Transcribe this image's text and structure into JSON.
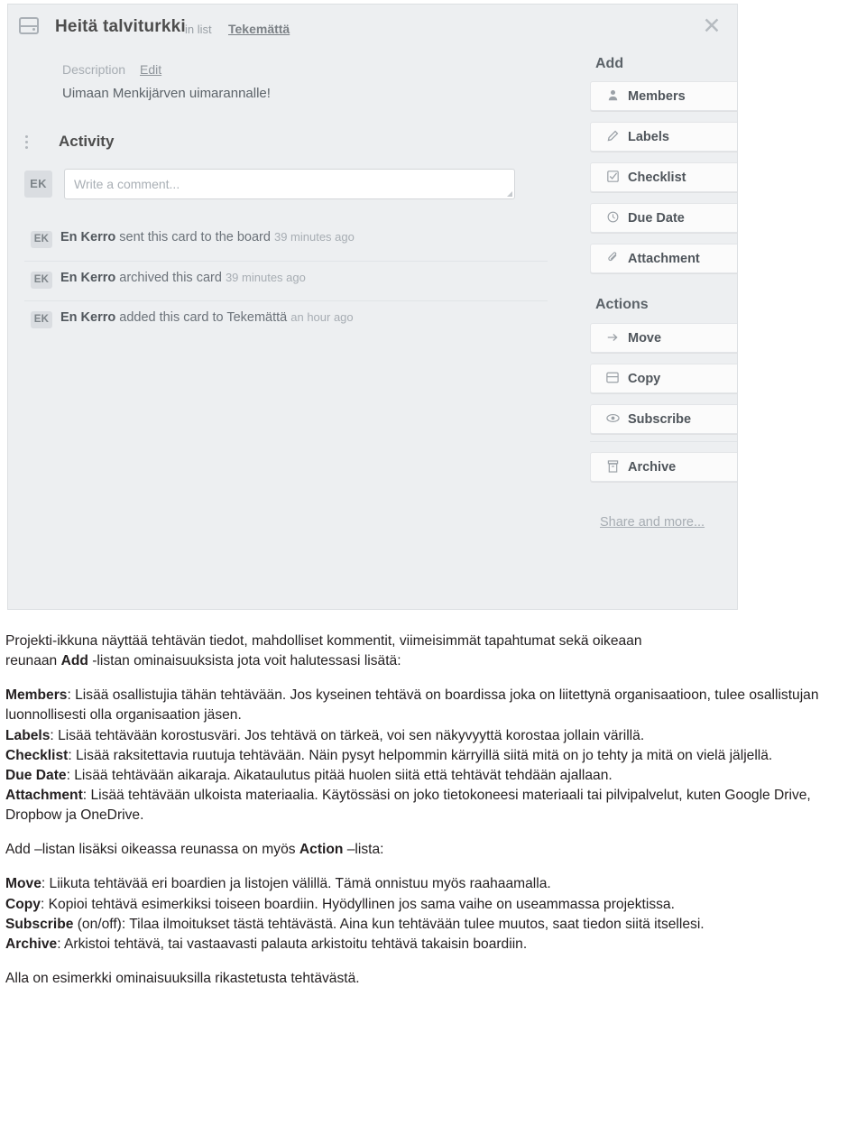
{
  "card": {
    "icon": "card-icon",
    "title": "Heitä talviturkki",
    "in_list_label": "in list",
    "list_name": "Tekemättä",
    "close_label": "✕",
    "description": {
      "label": "Description",
      "edit_label": "Edit",
      "text": "Uimaan Menkijärven uimarannalle!"
    },
    "activity": {
      "heading": "Activity",
      "comment_placeholder": "Write a comment...",
      "avatar_initials": "EK",
      "entries": [
        {
          "avatar": "EK",
          "author": "En Kerro",
          "action": "sent this card to the board",
          "time": "39 minutes ago"
        },
        {
          "avatar": "EK",
          "author": "En Kerro",
          "action": "archived this card",
          "time": "39 minutes ago"
        },
        {
          "avatar": "EK",
          "author": "En Kerro",
          "action": "added this card to Tekemättä",
          "time": "an hour ago"
        }
      ]
    },
    "sidebar": {
      "add_heading": "Add",
      "add_items": [
        {
          "icon": "person-icon",
          "glyph": "♟",
          "label": "Members"
        },
        {
          "icon": "label-tag-icon",
          "glyph": "✐",
          "label": "Labels"
        },
        {
          "icon": "checkbox-icon",
          "glyph": "☑",
          "label": "Checklist"
        },
        {
          "icon": "clock-icon",
          "glyph": "◴",
          "label": "Due Date"
        },
        {
          "icon": "paperclip-icon",
          "glyph": "✐",
          "label": "Attachment"
        }
      ],
      "actions_heading": "Actions",
      "action_items": [
        {
          "icon": "arrow-right-icon",
          "glyph": "→",
          "label": "Move"
        },
        {
          "icon": "copy-card-icon",
          "glyph": "▤",
          "label": "Copy"
        },
        {
          "icon": "eye-icon",
          "glyph": "◉",
          "label": "Subscribe"
        },
        {
          "icon": "archive-box-icon",
          "glyph": "▥",
          "label": "Archive"
        }
      ],
      "share_link": "Share and more..."
    }
  },
  "prose": {
    "intro_1": "Projekti-ikkuna näyttää tehtävän tiedot, mahdolliset kommentit, viimeisimmät tapahtumat sekä oikeaan",
    "intro_2_pre": "reunaan ",
    "intro_2_bold": "Add",
    "intro_2_post": " -listan ominaisuuksista jota voit halutessasi lisätä:",
    "members_term": "Members",
    "members_text": ": Lisää osallistujia tähän tehtävään. Jos kyseinen tehtävä on boardissa joka on liitettynä organisaatioon, tulee osallistujan luonnollisesti olla organisaation jäsen.",
    "labels_term": "Labels",
    "labels_text": ": Lisää tehtävään korostusväri. Jos tehtävä on tärkeä, voi sen näkyvyyttä korostaa jollain värillä.",
    "checklist_term": "Checklist",
    "checklist_text": ": Lisää raksitettavia ruutuja tehtävään. Näin pysyt helpommin kärryillä siitä mitä on jo tehty ja mitä on vielä jäljellä.",
    "duedate_term": "Due Date",
    "duedate_text": ": Lisää tehtävään aikaraja. Aikataulutus pitää huolen siitä että tehtävät tehdään ajallaan.",
    "attachment_term": "Attachment",
    "attachment_text": ": Lisää tehtävään ulkoista materiaalia. Käytössäsi on joko tietokoneesi materiaali tai pilvipalvelut, kuten Google Drive, Dropbow ja OneDrive.",
    "action_intro_pre": "Add –listan lisäksi oikeassa reunassa on myös ",
    "action_intro_bold": "Action",
    "action_intro_post": " –lista:",
    "move_term": "Move",
    "move_text": ": Liikuta tehtävää eri boardien ja listojen välillä. Tämä onnistuu myös raahaamalla.",
    "copy_term": "Copy",
    "copy_text": ": Kopioi tehtävä esimerkiksi toiseen boardiin. Hyödyllinen jos sama vaihe on useammassa projektissa.",
    "subscribe_term": "Subscribe",
    "subscribe_text": " (on/off): Tilaa ilmoitukset tästä tehtävästä. Aina kun tehtävään tulee muutos, saat tiedon siitä itsellesi.",
    "archive_term": "Archive",
    "archive_text": ": Arkistoi tehtävä, tai vastaavasti palauta arkistoitu tehtävä takaisin boardiin.",
    "closing": "Alla on esimerkki ominaisuuksilla rikastetusta tehtävästä."
  }
}
